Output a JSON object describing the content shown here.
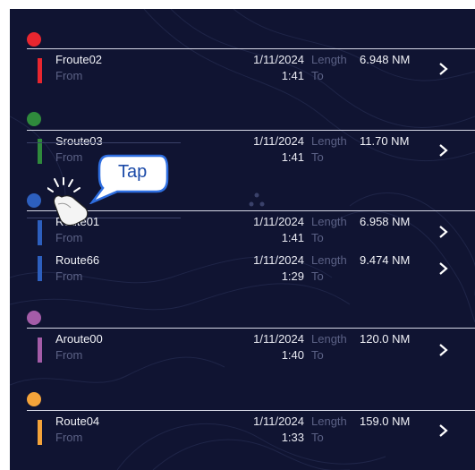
{
  "colors": {
    "background": "#101432",
    "red": "#e8262f",
    "green": "#2f8a3c",
    "blue": "#2d5fbe",
    "purple": "#a45ca8",
    "orange": "#f4a33a",
    "callout": "#2e6ee0"
  },
  "callout": {
    "label": "Tap"
  },
  "routes": [
    {
      "name": "Froute02",
      "from": "From",
      "date": "1/11/2024",
      "time": "1:41",
      "length_label": "Length",
      "to": "To",
      "length": "6.948 NM"
    },
    {
      "name": "Sroute03",
      "from": "From",
      "date": "1/11/2024",
      "time": "1:41",
      "length_label": "Length",
      "to": "To",
      "length": "11.70 NM"
    },
    {
      "name": "Route01",
      "from": "From",
      "date": "1/11/2024",
      "time": "1:41",
      "length_label": "Length",
      "to": "To",
      "length": "6.958 NM"
    },
    {
      "name": "Route66",
      "from": "From",
      "date": "1/11/2024",
      "time": "1:29",
      "length_label": "Length",
      "to": "To",
      "length": "9.474 NM"
    },
    {
      "name": "Aroute00",
      "from": "From",
      "date": "1/11/2024",
      "time": "1:40",
      "length_label": "Length",
      "to": "To",
      "length": "120.0 NM"
    },
    {
      "name": "Route04",
      "from": "From",
      "date": "1/11/2024",
      "time": "1:33",
      "length_label": "Length",
      "to": "To",
      "length": "159.0 NM"
    }
  ]
}
